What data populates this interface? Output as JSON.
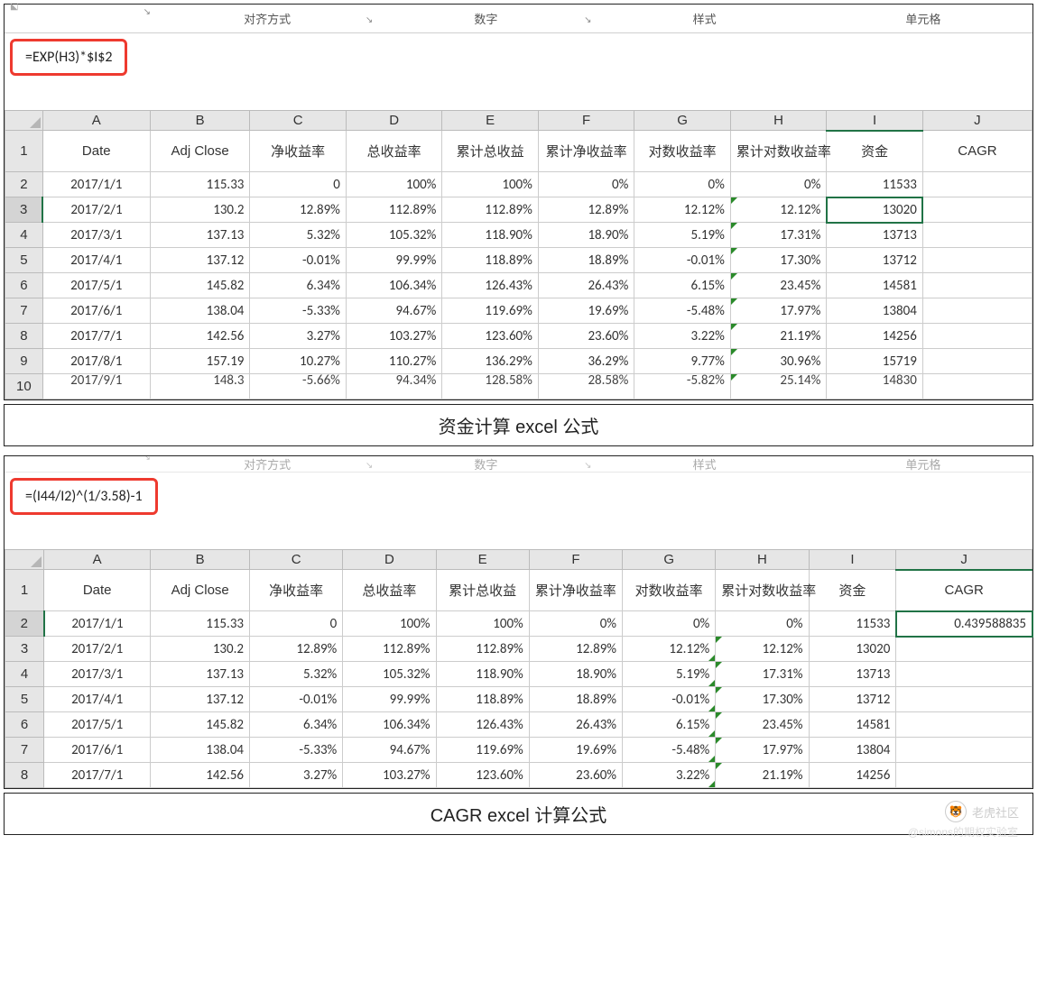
{
  "ribbon": {
    "align": "对齐方式",
    "number": "数字",
    "styles": "样式",
    "cells": "单元格",
    "dialog_launcher": "↘"
  },
  "panel1": {
    "formula": "=EXP(H3)*$I$2",
    "col_letters": [
      "A",
      "B",
      "C",
      "D",
      "E",
      "F",
      "G",
      "H",
      "I",
      "J"
    ],
    "selected_col_index": 8,
    "selected_cell": {
      "row": 3,
      "col": 8
    },
    "headers": [
      "Date",
      "Adj Close",
      "净收益率",
      "总收益率",
      "累计总收益",
      "累计净收益率",
      "对数收益率",
      "累计对数收益率",
      "资金",
      "CAGR"
    ],
    "rows": [
      {
        "n": 2,
        "c": [
          "2017/1/1",
          "115.33",
          "0",
          "100%",
          "100%",
          "0%",
          "0%",
          "0%",
          "11533",
          ""
        ]
      },
      {
        "n": 3,
        "c": [
          "2017/2/1",
          "130.2",
          "12.89%",
          "112.89%",
          "112.89%",
          "12.89%",
          "12.12%",
          "12.12%",
          "13020",
          ""
        ]
      },
      {
        "n": 4,
        "c": [
          "2017/3/1",
          "137.13",
          "5.32%",
          "105.32%",
          "118.90%",
          "18.90%",
          "5.19%",
          "17.31%",
          "13713",
          ""
        ]
      },
      {
        "n": 5,
        "c": [
          "2017/4/1",
          "137.12",
          "-0.01%",
          "99.99%",
          "118.89%",
          "18.89%",
          "-0.01%",
          "17.30%",
          "13712",
          ""
        ]
      },
      {
        "n": 6,
        "c": [
          "2017/5/1",
          "145.82",
          "6.34%",
          "106.34%",
          "126.43%",
          "26.43%",
          "6.15%",
          "23.45%",
          "14581",
          ""
        ]
      },
      {
        "n": 7,
        "c": [
          "2017/6/1",
          "138.04",
          "-5.33%",
          "94.67%",
          "119.69%",
          "19.69%",
          "-5.48%",
          "17.97%",
          "13804",
          ""
        ]
      },
      {
        "n": 8,
        "c": [
          "2017/7/1",
          "142.56",
          "3.27%",
          "103.27%",
          "123.60%",
          "23.60%",
          "3.22%",
          "21.19%",
          "14256",
          ""
        ]
      },
      {
        "n": 9,
        "c": [
          "2017/8/1",
          "157.19",
          "10.27%",
          "110.27%",
          "136.29%",
          "36.29%",
          "9.77%",
          "30.96%",
          "15719",
          ""
        ]
      },
      {
        "n": 10,
        "c": [
          "2017/9/1",
          "148.3",
          "-5.66%",
          "94.34%",
          "128.58%",
          "28.58%",
          "-5.82%",
          "25.14%",
          "14830",
          ""
        ]
      }
    ],
    "caption": "资金计算 excel 公式"
  },
  "panel2": {
    "formula": "=(I44/I2)^(1/3.58)-1",
    "col_letters": [
      "A",
      "B",
      "C",
      "D",
      "E",
      "F",
      "G",
      "H",
      "I",
      "J"
    ],
    "selected_cell": {
      "row": 2,
      "col": 9
    },
    "headers": [
      "Date",
      "Adj Close",
      "净收益率",
      "总收益率",
      "累计总收益",
      "累计净收益率",
      "对数收益率",
      "累计对数收益率",
      "资金",
      "CAGR"
    ],
    "rows": [
      {
        "n": 2,
        "c": [
          "2017/1/1",
          "115.33",
          "0",
          "100%",
          "100%",
          "0%",
          "0%",
          "0%",
          "11533",
          "0.439588835"
        ]
      },
      {
        "n": 3,
        "c": [
          "2017/2/1",
          "130.2",
          "12.89%",
          "112.89%",
          "112.89%",
          "12.89%",
          "12.12%",
          "12.12%",
          "13020",
          ""
        ]
      },
      {
        "n": 4,
        "c": [
          "2017/3/1",
          "137.13",
          "5.32%",
          "105.32%",
          "118.90%",
          "18.90%",
          "5.19%",
          "17.31%",
          "13713",
          ""
        ]
      },
      {
        "n": 5,
        "c": [
          "2017/4/1",
          "137.12",
          "-0.01%",
          "99.99%",
          "118.89%",
          "18.89%",
          "-0.01%",
          "17.30%",
          "13712",
          ""
        ]
      },
      {
        "n": 6,
        "c": [
          "2017/5/1",
          "145.82",
          "6.34%",
          "106.34%",
          "126.43%",
          "26.43%",
          "6.15%",
          "23.45%",
          "14581",
          ""
        ]
      },
      {
        "n": 7,
        "c": [
          "2017/6/1",
          "138.04",
          "-5.33%",
          "94.67%",
          "119.69%",
          "19.69%",
          "-5.48%",
          "17.97%",
          "13804",
          ""
        ]
      },
      {
        "n": 8,
        "c": [
          "2017/7/1",
          "142.56",
          "3.27%",
          "103.27%",
          "123.60%",
          "23.60%",
          "3.22%",
          "21.19%",
          "14256",
          ""
        ]
      }
    ],
    "caption": "CAGR excel 计算公式"
  },
  "watermark": {
    "brand": "老虎社区",
    "author": "@simons的期权实验室"
  }
}
